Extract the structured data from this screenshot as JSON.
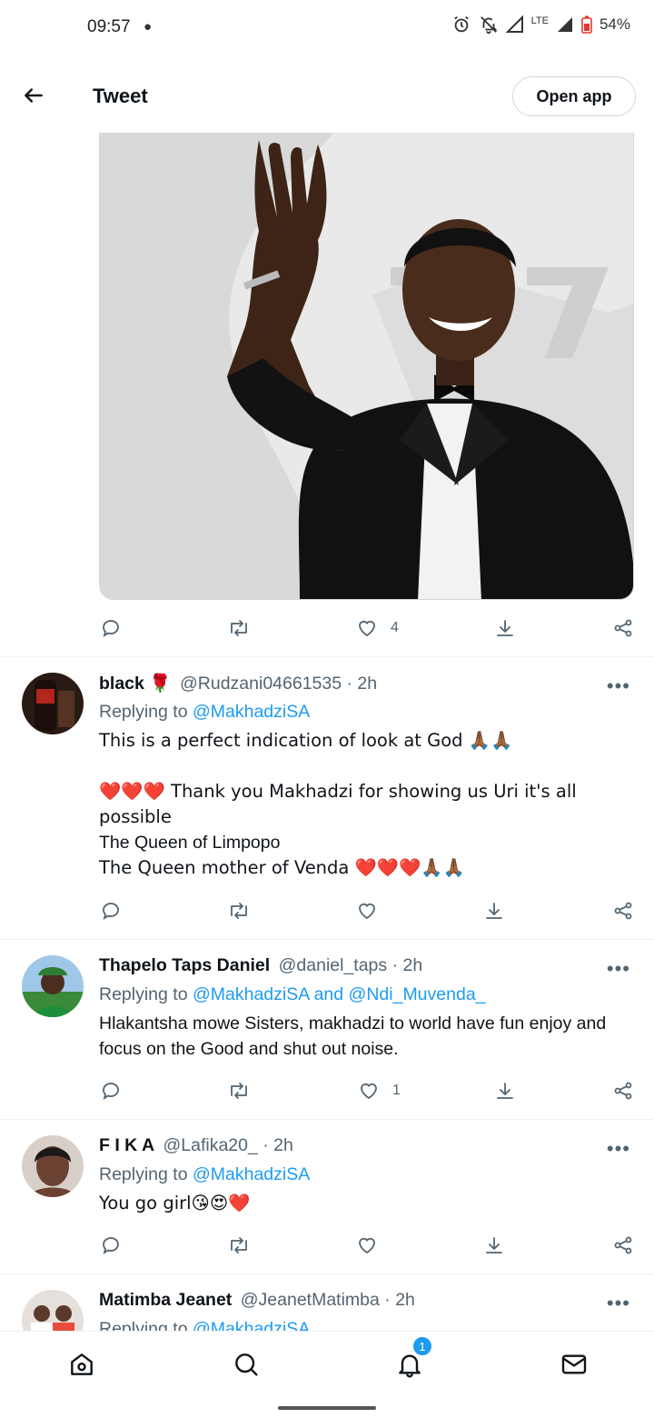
{
  "status_bar": {
    "time": "09:57",
    "network": "LTE",
    "battery": "54%"
  },
  "header": {
    "title": "Tweet",
    "open_app_label": "Open app"
  },
  "main_tweet": {
    "like_count": "4"
  },
  "replies": [
    {
      "name": "black 🌹",
      "handle": "@Rudzani04661535",
      "time": "· 2h",
      "replying_prefix": "Replying to",
      "replying_to": "@MakhadziSA",
      "body_lines": [
        "This is a perfect indication of look at God 🙏🏾🙏🏾",
        "",
        "❤️❤️❤️ Thank you Makhadzi for showing us Uri it's all possible",
        "The Queen of Limpopo",
        "The Queen mother of Venda ❤️❤️❤️🙏🏾🙏🏾"
      ],
      "like_count": ""
    },
    {
      "name": "Thapelo Taps Daniel",
      "handle": "@daniel_taps",
      "time": "· 2h",
      "replying_prefix": "Replying to",
      "replying_to": "@MakhadziSA and @Ndi_Muvenda_",
      "body_lines": [
        "Hlakantsha mowe Sisters, makhadzi to world have fun enjoy and focus on the Good and shut out noise."
      ],
      "like_count": "1"
    },
    {
      "name": "F I K A",
      "handle": "@Lafika20_",
      "time": "· 2h",
      "replying_prefix": "Replying to",
      "replying_to": "@MakhadziSA",
      "body_lines": [
        "You go girl😘😍❤️"
      ],
      "like_count": ""
    },
    {
      "name": "Matimba Jeanet",
      "handle": "@JeanetMatimba",
      "time": "· 2h",
      "replying_prefix": "Replying to",
      "replying_to": "@MakhadziSA"
    }
  ],
  "more_label": "•••",
  "bottom_nav": {
    "notifications_badge": "1"
  },
  "colors": {
    "accent": "#1d9bf0",
    "text": "#0f1419",
    "muted": "#536471",
    "border": "#cfd9de",
    "heart": "#e0245e"
  }
}
